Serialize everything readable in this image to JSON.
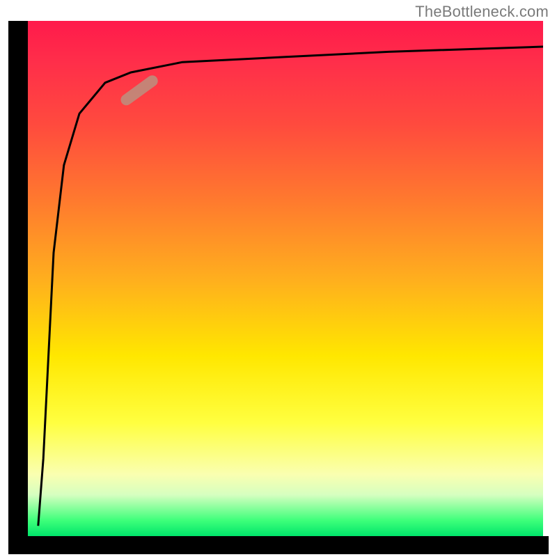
{
  "attribution": "TheBottleneck.com",
  "chart_data": {
    "type": "line",
    "title": "",
    "xlabel": "",
    "ylabel": "",
    "xlim": [
      0,
      100
    ],
    "ylim": [
      0,
      100
    ],
    "grid": false,
    "legend": false,
    "background": {
      "gradient_stops": [
        {
          "pos": 0.0,
          "color": "#ff1a4b"
        },
        {
          "pos": 0.5,
          "color": "#ffae1e"
        },
        {
          "pos": 0.78,
          "color": "#ffff40"
        },
        {
          "pos": 0.97,
          "color": "#3dff7a"
        },
        {
          "pos": 1.0,
          "color": "#00e56a"
        }
      ]
    },
    "series": [
      {
        "name": "bottleneck-curve",
        "color": "#000000",
        "x": [
          2,
          3,
          4,
          5,
          7,
          10,
          15,
          20,
          30,
          50,
          70,
          100
        ],
        "y": [
          2,
          15,
          35,
          55,
          72,
          82,
          88,
          90,
          92,
          93,
          94,
          95
        ]
      }
    ],
    "annotations": [
      {
        "name": "highlight-segment",
        "color": "#c08a7b",
        "x_range": [
          14,
          22
        ],
        "y_range": [
          83,
          89
        ]
      }
    ]
  }
}
